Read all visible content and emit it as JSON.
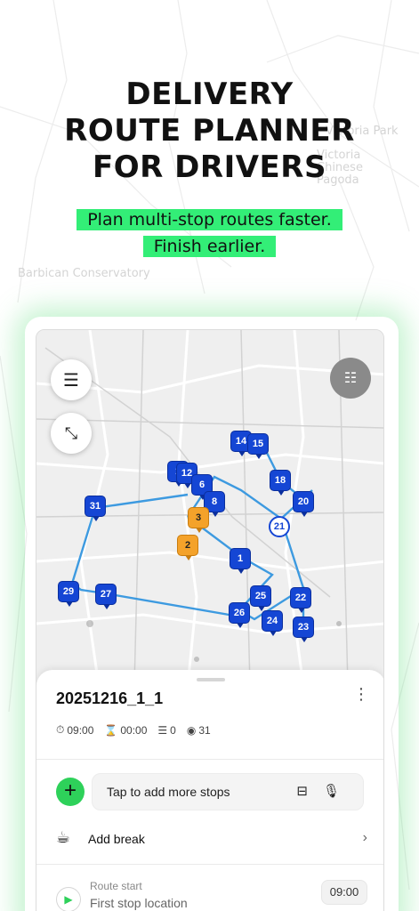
{
  "background": {
    "labels": [
      "Barbican Conservatory",
      "Victoria Park",
      "Victoria Chinese Pagoda"
    ]
  },
  "headline": [
    "DELIVERY",
    "ROUTE PLANNER",
    "FOR DRIVERS"
  ],
  "tagline": [
    "Plan multi-stop routes faster.",
    "Finish earlier."
  ],
  "map": {
    "controls": {
      "menu_icon": "hamburger-icon",
      "optimize_icon": "route-shuffle-icon",
      "list_icon": "list-toggle-icon"
    },
    "stops": [
      {
        "label": "14",
        "kind": "stop"
      },
      {
        "label": "15",
        "kind": "stop"
      },
      {
        "label": "1",
        "kind": "stop"
      },
      {
        "label": "12",
        "kind": "stop"
      },
      {
        "label": "6",
        "kind": "stop"
      },
      {
        "label": "18",
        "kind": "stop"
      },
      {
        "label": "8",
        "kind": "stop"
      },
      {
        "label": "20",
        "kind": "stop"
      },
      {
        "label": "31",
        "kind": "stop"
      },
      {
        "label": "3",
        "kind": "current"
      },
      {
        "label": "21",
        "kind": "circle"
      },
      {
        "label": "2",
        "kind": "current"
      },
      {
        "label": "1",
        "kind": "stop"
      },
      {
        "label": "29",
        "kind": "stop"
      },
      {
        "label": "27",
        "kind": "stop"
      },
      {
        "label": "25",
        "kind": "stop"
      },
      {
        "label": "22",
        "kind": "stop"
      },
      {
        "label": "26",
        "kind": "stop"
      },
      {
        "label": "24",
        "kind": "stop"
      },
      {
        "label": "23",
        "kind": "stop"
      }
    ]
  },
  "sheet": {
    "route_name": "20251216_1_1",
    "stats": {
      "start_time": "09:00",
      "duration": "00:00",
      "breaks": "0",
      "stops": "31"
    },
    "add_stops_placeholder": "Tap to add more stops",
    "add_break_label": "Add break",
    "route_start_label": "Route start",
    "route_start_value": "First stop location",
    "route_start_time": "09:00"
  },
  "colors": {
    "accent_green": "#33ee77",
    "pin_blue": "#1546d4",
    "pin_orange": "#f4a22a",
    "route_line": "#3d9ae0"
  }
}
